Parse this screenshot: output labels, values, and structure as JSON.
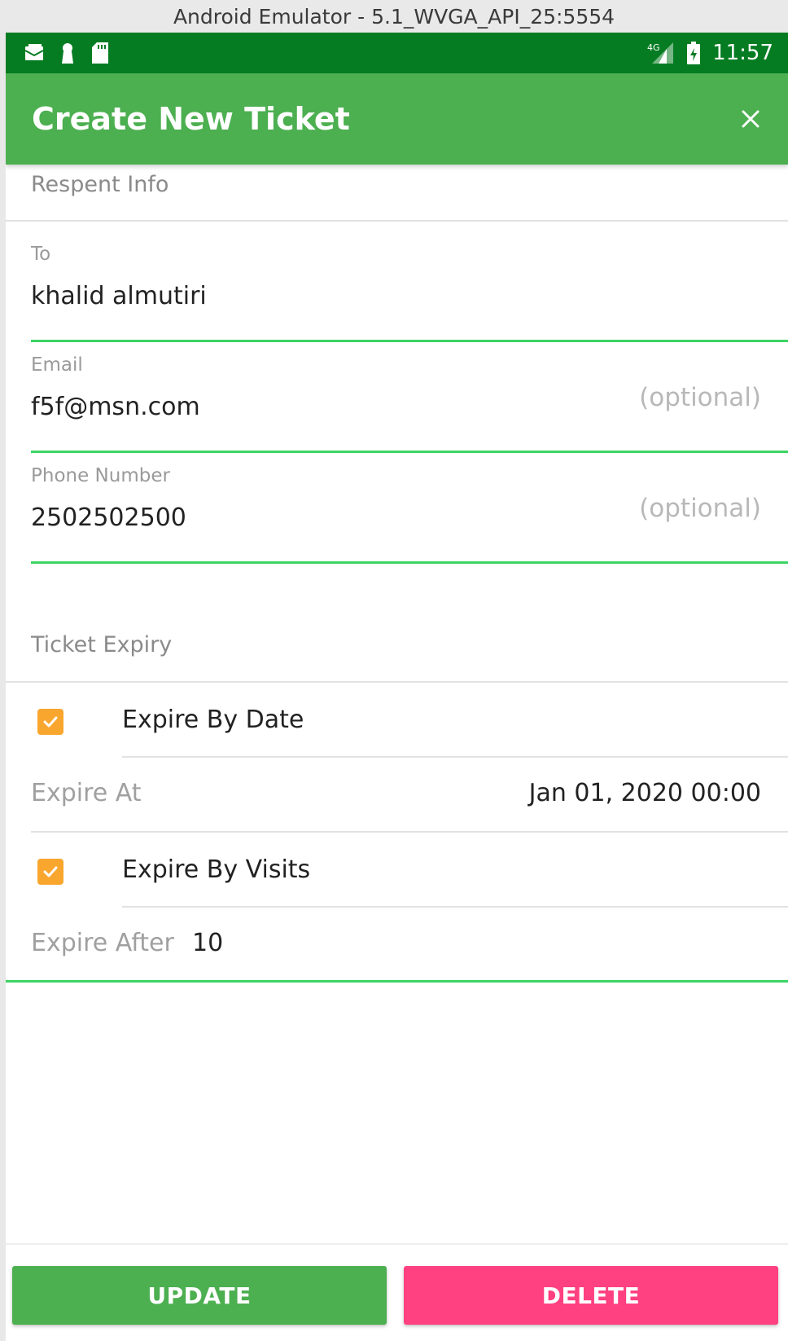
{
  "window": {
    "title": "Android Emulator - 5.1_WVGA_API_25:5554"
  },
  "status_bar": {
    "time": "11:57",
    "network": "4G",
    "icons": [
      "mail-icon",
      "keyhole-icon",
      "sd-card-icon",
      "signal-icon",
      "battery-icon"
    ],
    "color": "#067c22"
  },
  "app_bar": {
    "title": "Create New Ticket",
    "close_icon": "close-icon",
    "color": "#4caf50"
  },
  "recipient_section": {
    "header": "Respent Info",
    "to": {
      "label": "To",
      "value": "khalid almutiri"
    },
    "email": {
      "label": "Email",
      "value": "f5f@msn.com",
      "hint": "(optional)"
    },
    "phone": {
      "label": "Phone Number",
      "value": "2502502500",
      "hint": "(optional)"
    }
  },
  "expiry_section": {
    "header": "Ticket Expiry",
    "expire_by_date": {
      "label": "Expire By Date",
      "checked": true
    },
    "expire_at": {
      "label": "Expire At",
      "value": "Jan 01, 2020 00:00"
    },
    "expire_by_visits": {
      "label": "Expire By Visits",
      "checked": true
    },
    "expire_after": {
      "label": "Expire After",
      "value": "10"
    }
  },
  "buttons": {
    "update": {
      "label": "UPDATE",
      "color": "#4caf50"
    },
    "delete": {
      "label": "DELETE",
      "color": "#ff4081"
    }
  },
  "colors": {
    "accent_underline": "#3dd464",
    "checkbox": "#f9a62e"
  }
}
